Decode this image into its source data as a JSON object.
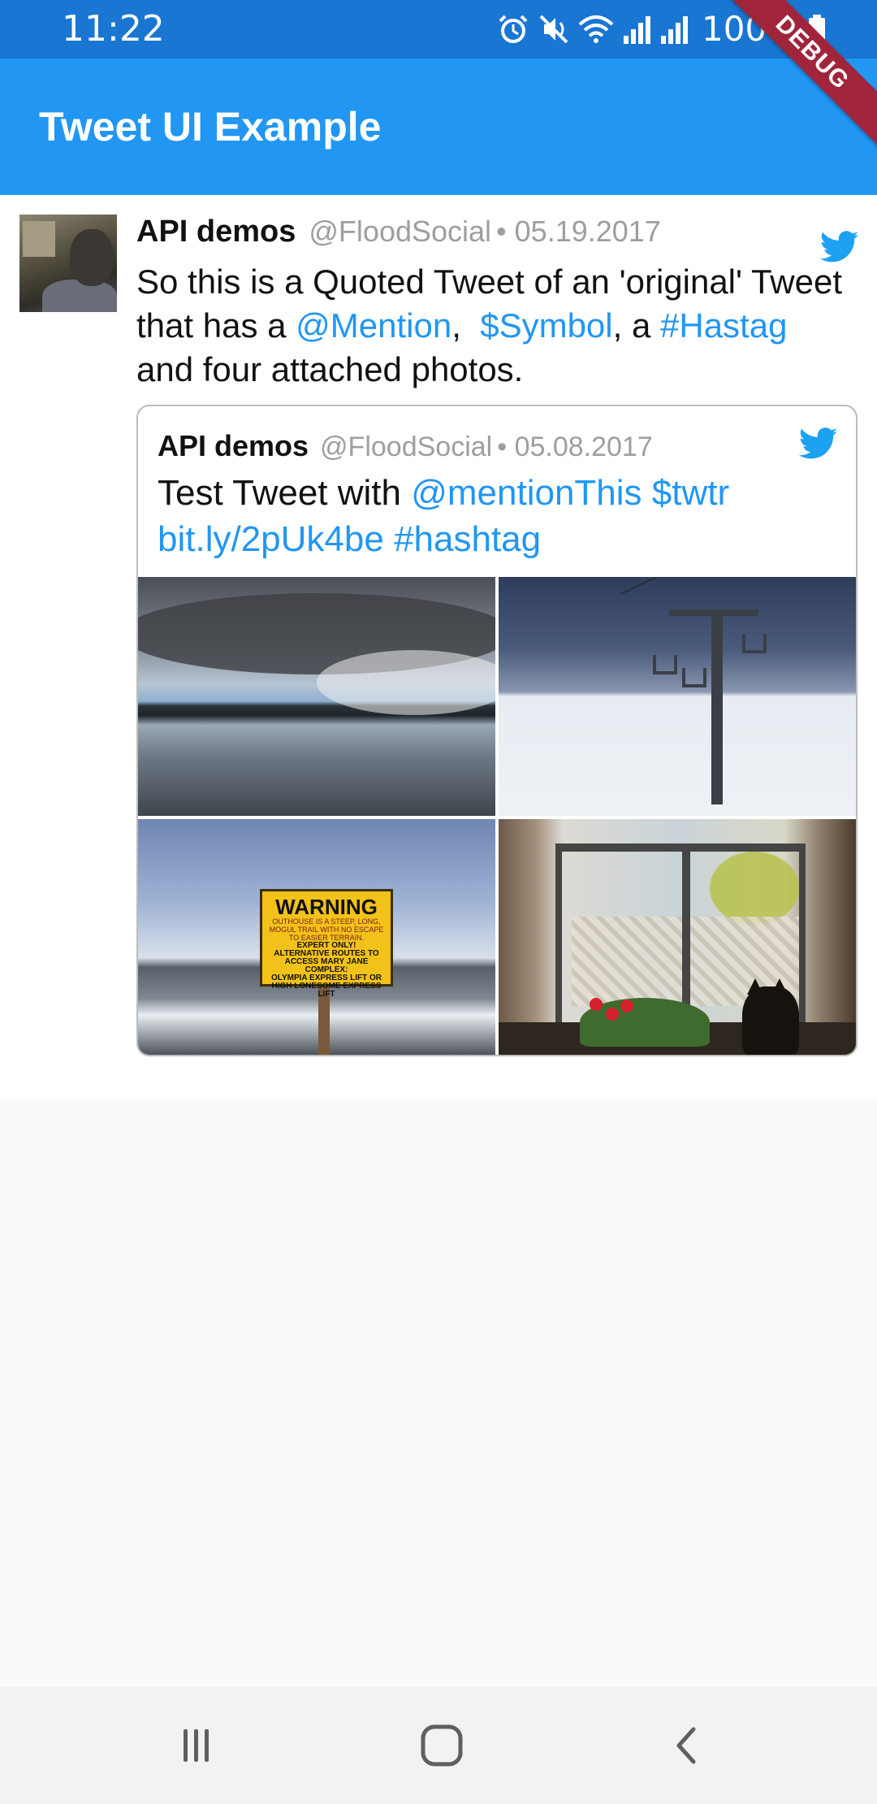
{
  "status_bar": {
    "time": "11:22",
    "battery": "100%",
    "icons": [
      "alarm-icon",
      "mute-icon",
      "wifi-icon",
      "signal-icon",
      "signal-icon",
      "battery-icon"
    ]
  },
  "app_bar": {
    "title": "Tweet UI Example",
    "color": "#2196f3",
    "status_color": "#1976d2"
  },
  "debug_banner": "DEBUG",
  "tweet": {
    "user_name": "API demos",
    "handle": "@FloodSocial",
    "date": "• 05.19.2017",
    "text": {
      "part1": "So this is a Quoted Tweet of an 'original' Tweet that has a ",
      "mention": "@Mention",
      "part2": ",  ",
      "symbol": "$Symbol",
      "part3": ", a ",
      "hashtag": "#Hastag",
      "part4": " and four attached photos."
    },
    "quoted": {
      "user_name": "API demos",
      "handle": "@FloodSocial",
      "date": "• 05.08.2017",
      "text": {
        "part1": "Test Tweet with ",
        "mention": "@mentionThis",
        "symbol": "$twtr",
        "url": "bit.ly/2pUk4be",
        "hashtag": "#hashtag"
      },
      "photos": [
        "lake-photo",
        "ski-lift-photo",
        "warning-sign-photo",
        "window-cat-photo"
      ],
      "warning_sign": {
        "title": "WARNING",
        "lines": [
          "OUTHOUSE IS A STEEP, LONG,",
          "MOGUL TRAIL WITH NO ESCAPE",
          "TO EASIER TERRAIN."
        ],
        "expert": "EXPERT ONLY!",
        "routes": [
          "ALTERNATIVE ROUTES TO",
          "ACCESS MARY JANE COMPLEX:"
        ],
        "lifts": [
          "OLYMPIA EXPRESS LIFT OR",
          "HIGH LONESOME EXPRESS LIFT"
        ]
      }
    },
    "link_color": "#2196f3",
    "twitter_blue": "#1da1f2"
  },
  "nav_bar": {
    "buttons": [
      "recent-apps-icon",
      "home-icon",
      "back-icon"
    ]
  }
}
